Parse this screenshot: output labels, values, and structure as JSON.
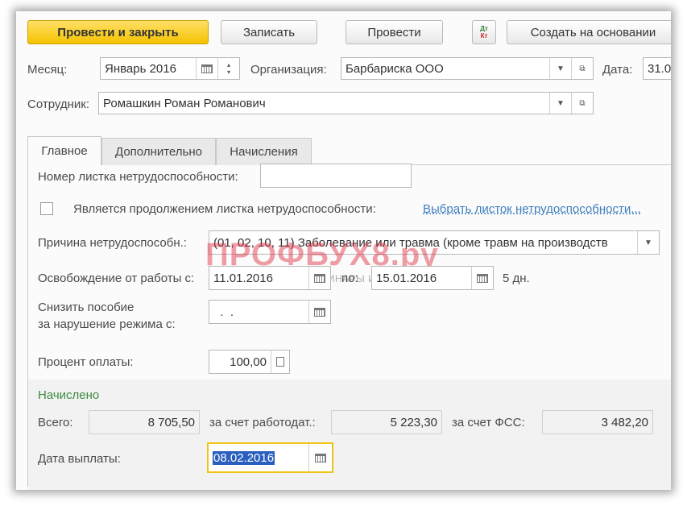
{
  "toolbar": {
    "post_close": "Провести и закрыть",
    "save": "Записать",
    "post": "Провести",
    "dtkt_top": "Дт",
    "dtkt_bottom": "Кт",
    "create_based": "Создать на основании"
  },
  "header": {
    "month_label": "Месяц:",
    "month_value": "Январь 2016",
    "org_label": "Организация:",
    "org_value": "Барбариска ООО",
    "date_label": "Дата:",
    "date_value": "31.0",
    "employee_label": "Сотрудник:",
    "employee_value": "Ромашкин Роман Романович"
  },
  "tabs": [
    {
      "label": "Главное"
    },
    {
      "label": "Дополнительно"
    },
    {
      "label": "Начисления"
    }
  ],
  "form": {
    "sheet_number_label": "Номер листка нетрудоспособности:",
    "sheet_number_value": "",
    "continuation_label": "Является продолжением листка нетрудоспособности:",
    "choose_sheet_link": "Выбрать листок нетрудоспособности...",
    "reason_label": "Причина нетрудоспособн.:",
    "reason_value": "(01, 02, 10, 11) Заболевание или травма (кроме травм на производств",
    "release_label": "Освобождение от работы с:",
    "release_from": "11.01.2016",
    "to_label": "по:",
    "release_to": "15.01.2016",
    "days": "5 дн.",
    "reduce_label_line1": "Снизить пособие",
    "reduce_label_line2": "за нарушение режима с:",
    "reduce_value": "  .  .",
    "percent_label": "Процент оплаты:",
    "percent_value": "100,00"
  },
  "accrued": {
    "section_title": "Начислено",
    "total_label": "Всего:",
    "total_value": "8 705,50",
    "employer_label": "за счет работодат.:",
    "employer_value": "5 223,30",
    "fss_label": "за счет ФСС:",
    "fss_value": "3 482,20",
    "pay_date_label": "Дата выплаты:",
    "pay_date_value": "08.02.2016"
  },
  "watermark": {
    "main": "ПРОФБУХ8.ру",
    "sub": "ОНЛАЙН-СЕМИНАРЫ И ВИДЕОКУРСЫ 1С:8"
  },
  "colors": {
    "primary_button": "#f5c200",
    "link": "#3f7fbf",
    "section_green": "#3c8a3c",
    "focus_border": "#f0c419",
    "selection": "#2b5fbf"
  }
}
